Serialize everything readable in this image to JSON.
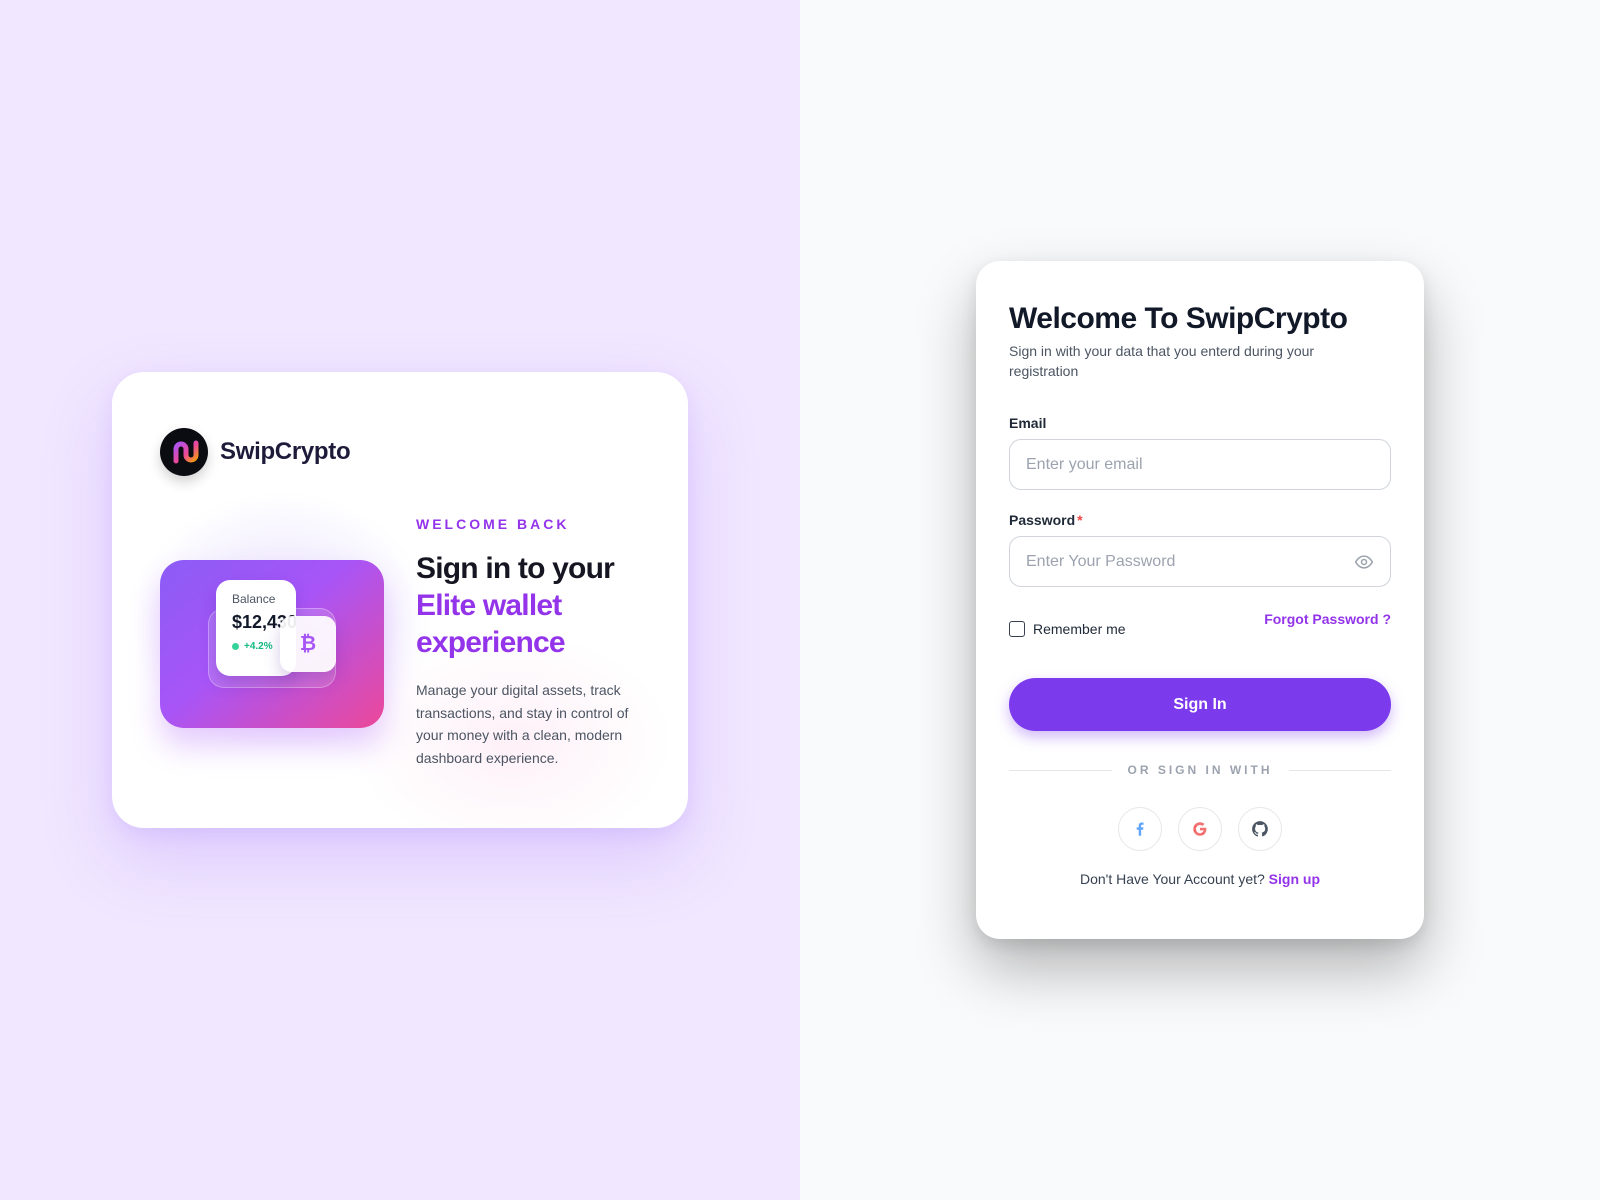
{
  "colors": {
    "left_background": "#f1e7ff",
    "right_background": "#f9fafb",
    "accent": "#9333ea",
    "button": "#7c3aed",
    "success": "#10b981",
    "required": "#ef4444"
  },
  "brand": {
    "name": "SwipCrypto",
    "logo_icon": "swipcrypto-logo-icon"
  },
  "promo": {
    "kicker": "WELCOME BACK",
    "headline_line1": "Sign in to your",
    "headline_line2": "Elite wallet",
    "headline_line3": "experience",
    "description": "Manage your digital assets, track transactions, and stay in control of your money with a clean, modern dashboard experience.",
    "wallet": {
      "balance_label": "Balance",
      "balance_amount": "$12,430",
      "change": "+4.2%",
      "coin_symbol": "₿",
      "coin_icon": "bitcoin-icon"
    }
  },
  "signin": {
    "title": "Welcome To SwipCrypto",
    "subtitle": "Sign in with your data that you enterd during your registration",
    "email_label": "Email",
    "email_placeholder": "Enter your email",
    "password_label": "Password",
    "password_required_mark": "*",
    "password_placeholder": "Enter Your Password",
    "password_toggle_icon": "eye-icon",
    "remember_label": "Remember me",
    "remember_checked": false,
    "forgot_link": "Forgot Password ?",
    "submit_label": "Sign In",
    "divider_text": "OR SIGN IN WITH",
    "social_icons": [
      "facebook-icon",
      "google-icon",
      "github-icon"
    ],
    "signup_prompt": "Don't Have Your Account yet?",
    "signup_link": "Sign up"
  }
}
